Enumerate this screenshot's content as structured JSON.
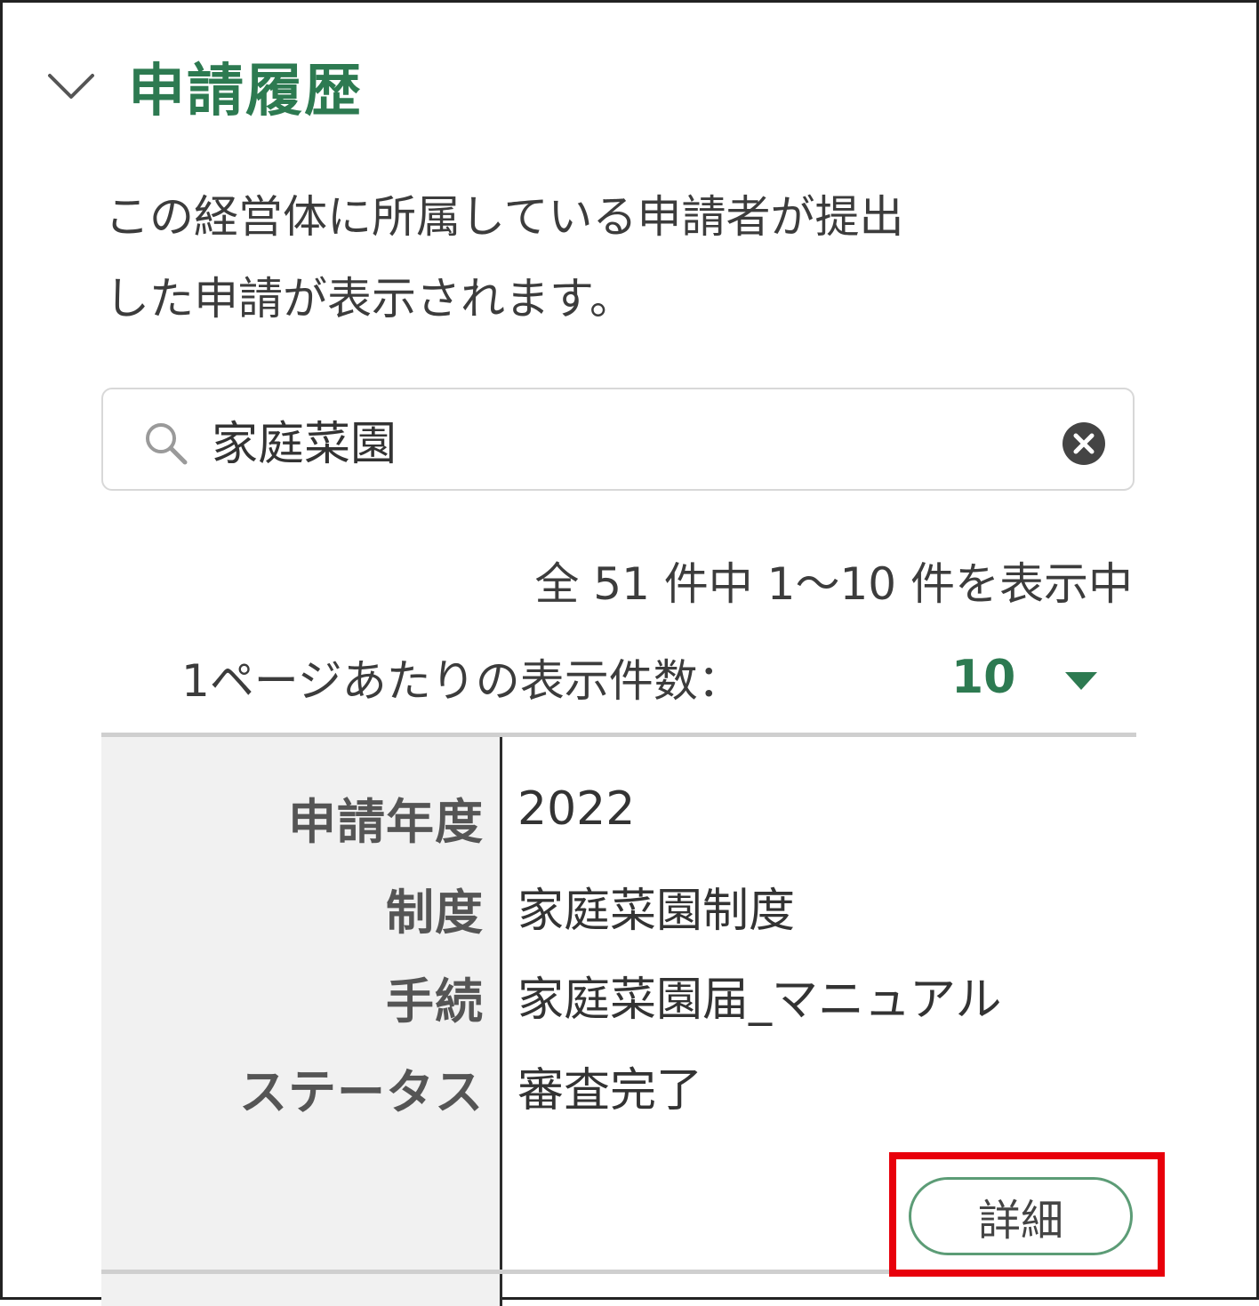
{
  "section": {
    "title": "申請履歴",
    "description_line1": "この経営体に所属している申請者が提出",
    "description_line2": "した申請が表示されます。"
  },
  "search": {
    "value": "家庭菜園",
    "icon": "search-icon",
    "clear_icon": "clear-circle-icon"
  },
  "results": {
    "summary": "全 51 件中 1～10 件を表示中",
    "per_page_label": "1ページあたりの表示件数：",
    "per_page_value": "10"
  },
  "record": {
    "fields": [
      {
        "label": "申請年度",
        "value": "2022"
      },
      {
        "label": "制度",
        "value": "家庭菜園制度"
      },
      {
        "label": "手続",
        "value": "家庭菜園届_マニュアル"
      },
      {
        "label": "ステータス",
        "value": "審査完了"
      }
    ],
    "detail_button_label": "詳細"
  },
  "colors": {
    "accent_green": "#2d7a51",
    "highlight_red": "#e8000b"
  }
}
